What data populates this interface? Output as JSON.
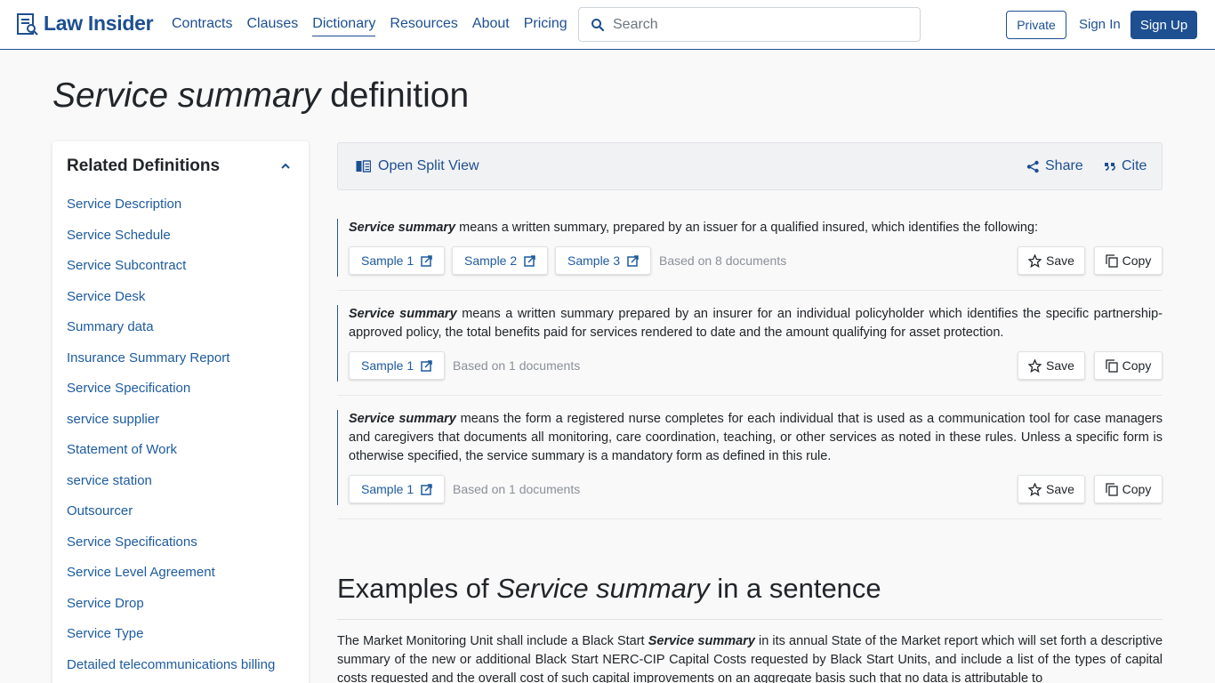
{
  "header": {
    "logo": "Law Insider",
    "nav": [
      "Contracts",
      "Clauses",
      "Dictionary",
      "Resources",
      "About",
      "Pricing"
    ],
    "active_nav": "Dictionary",
    "search_placeholder": "Search",
    "private_label": "Private",
    "signin_label": "Sign In",
    "signup_label": "Sign Up",
    "brand_color": "#1d4f91"
  },
  "title": {
    "term": "Service summary",
    "suffix": " definition"
  },
  "sidebar": {
    "title": "Related Definitions",
    "items": [
      "Service Description",
      "Service Schedule",
      "Service Subcontract",
      "Service Desk",
      "Summary data",
      "Insurance Summary Report",
      "Service Specification",
      "service supplier",
      "Statement of Work",
      "service station",
      "Outsourcer",
      "Service Specifications",
      "Service Level Agreement",
      "Service Drop",
      "Service Type",
      "Detailed telecommunications billing"
    ]
  },
  "toolbar": {
    "split_view": "Open Split View",
    "share": "Share",
    "cite": "Cite"
  },
  "definitions": [
    {
      "term": "Service summary",
      "text": " means a written summary, prepared by an issuer for a qualified insured, which identifies the following:",
      "samples": [
        "Sample 1",
        "Sample 2",
        "Sample 3"
      ],
      "based_on": "Based on 8 documents",
      "save": "Save",
      "copy": "Copy"
    },
    {
      "term": "Service summary",
      "text": " means a written summary prepared by an insurer for an individual policyholder which identifies the specific partnership-approved policy, the total benefits paid for services rendered to date and the amount qualifying for asset protection.",
      "samples": [
        "Sample 1"
      ],
      "based_on": "Based on 1 documents",
      "save": "Save",
      "copy": "Copy"
    },
    {
      "term": "Service summary",
      "text": " means the form a registered nurse completes for each individual that is used as a communication tool for case managers and caregivers that documents all monitoring, care coordination, teaching, or other services as noted in these rules. Unless a specific form is otherwise specified, the service summary is a mandatory form as defined in this rule.",
      "samples": [
        "Sample 1"
      ],
      "based_on": "Based on 1 documents",
      "save": "Save",
      "copy": "Copy"
    }
  ],
  "examples": {
    "title_prefix": "Examples of ",
    "title_term": "Service summary",
    "title_suffix": " in a sentence",
    "sentence_before": "The Market Monitoring Unit shall include a Black Start ",
    "sentence_term": "Service summary",
    "sentence_after": " in its annual State of the Market report which will set forth a descriptive summary of the new or additional Black Start NERC-CIP Capital Costs requested by Black Start Units, and include a list of the types of capital costs requested and the overall cost of such capital improvements on an aggregate basis such that no data is attributable to"
  }
}
